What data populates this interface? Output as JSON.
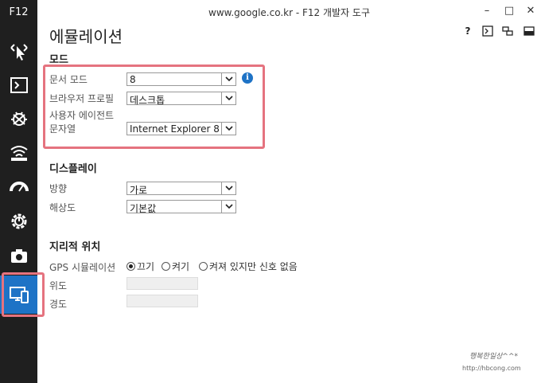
{
  "rail": {
    "label": "F12",
    "items": [
      "DOM 탐색기",
      "콘솔",
      "디버거",
      "네트워크",
      "UI 응답성",
      "프로파일러",
      "메모리",
      "에뮬레이션"
    ]
  },
  "window": {
    "title": "www.google.co.kr - F12 개발자 도구",
    "minimize": "–",
    "maximize": "□",
    "close": "✕"
  },
  "header": {
    "title": "에뮬레이션",
    "help": "?",
    "console_icon": "console-icon",
    "pin_icon": "pin-icon",
    "dock_icon": "dock-icon"
  },
  "mode": {
    "section": "모드",
    "document_mode_label": "문서 모드",
    "document_mode_value": "8",
    "browser_profile_label": "브라우저 프로필",
    "browser_profile_value": "데스크톱",
    "user_agent_label_1": "사용자 에이전트",
    "user_agent_label_2": "문자열",
    "user_agent_value": "Internet Explorer 8"
  },
  "display": {
    "section": "디스플레이",
    "orientation_label": "방향",
    "orientation_value": "가로",
    "resolution_label": "해상도",
    "resolution_value": "기본값"
  },
  "geo": {
    "section": "지리적 위치",
    "gps_label": "GPS 시뮬레이션",
    "options": [
      "끄기",
      "켜기",
      "켜져 있지만 신호 없음"
    ],
    "selected": "끄기",
    "latitude_label": "위도",
    "longitude_label": "경도"
  },
  "watermark": {
    "line1": "행복한일상^^*",
    "line2": "http://hbcong.com"
  },
  "colors": {
    "accent": "#1e73c6",
    "rail_bg": "#1f1f1f",
    "highlight": "#e5737f"
  }
}
